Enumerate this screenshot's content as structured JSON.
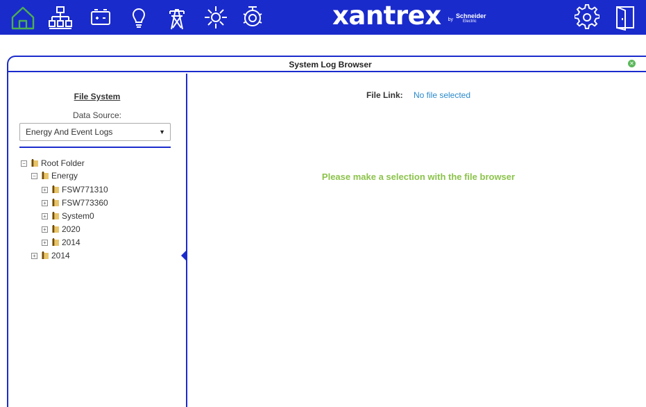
{
  "topbar": {
    "brand_name": "xantrex",
    "brand_by": "by",
    "brand_partner": "Schneider",
    "brand_partner_sub": "Electric",
    "accent_color": "#1a2bcc"
  },
  "nav": [
    {
      "icon": "home-icon",
      "active": true
    },
    {
      "icon": "network-icon"
    },
    {
      "icon": "battery-icon"
    },
    {
      "icon": "lightbulb-icon"
    },
    {
      "icon": "power-tower-icon"
    },
    {
      "icon": "sun-icon"
    },
    {
      "icon": "generator-icon"
    }
  ],
  "nav_right": [
    {
      "icon": "gear-icon"
    },
    {
      "icon": "logout-icon"
    }
  ],
  "panel": {
    "title": "System Log Browser"
  },
  "file_system": {
    "title": "File System",
    "data_source_label": "Data Source:",
    "data_source_value": "Energy And Event Logs"
  },
  "tree": [
    {
      "label": "Root Folder",
      "expanded": true,
      "level": 0
    },
    {
      "label": "Energy",
      "expanded": true,
      "level": 1
    },
    {
      "label": "FSW771310",
      "expanded": false,
      "level": 2
    },
    {
      "label": "FSW773360",
      "expanded": false,
      "level": 2
    },
    {
      "label": "System0",
      "expanded": false,
      "level": 2
    },
    {
      "label": "2020",
      "expanded": false,
      "level": 2
    },
    {
      "label": "2014",
      "expanded": false,
      "level": 2
    },
    {
      "label": "2014",
      "expanded": false,
      "level": 1
    }
  ],
  "file_link": {
    "label": "File Link:",
    "value": "No file selected"
  },
  "message": "Please make a selection with the file browser",
  "colors": {
    "selection_message": "#8bc34a",
    "link": "#2a8acb",
    "close_button": "#5cb85c"
  }
}
